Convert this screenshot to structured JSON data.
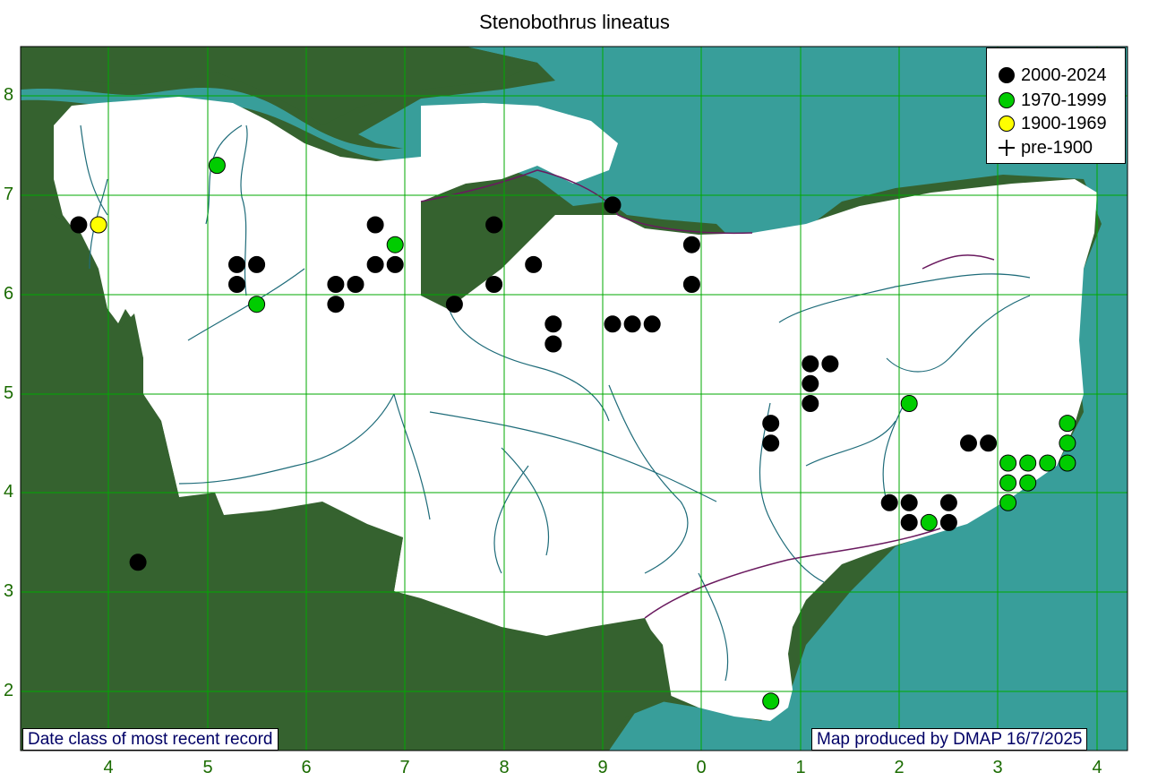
{
  "title": "Stenobothrus lineatus",
  "legend": [
    {
      "label": "2000-2024",
      "symbol": "circle",
      "color": "#000000"
    },
    {
      "label": "1970-1999",
      "symbol": "circle",
      "color": "#00cc00"
    },
    {
      "label": "1900-1969",
      "symbol": "circle",
      "color": "#ffff00"
    },
    {
      "label": "pre-1900",
      "symbol": "cross",
      "color": "#000000"
    }
  ],
  "captions": {
    "left": "Date class of most recent record",
    "right": "Map produced by DMAP 16/7/2025"
  },
  "axes": {
    "x_ticks": [
      "4",
      "5",
      "6",
      "7",
      "8",
      "9",
      "0",
      "1",
      "2",
      "3",
      "4"
    ],
    "y_ticks": [
      "8",
      "7",
      "6",
      "5",
      "4",
      "3",
      "2"
    ]
  },
  "colors": {
    "land_outside": "#35622f",
    "sea": "#389e9a",
    "county": "#ffffff",
    "grid": "#00aa00",
    "rivers": "#1f6c7a",
    "coast_mud": "#6a1a5f"
  },
  "chart_data": {
    "type": "scatter",
    "series": [
      {
        "name": "2000-2024",
        "color": "#000000",
        "points": [
          [
            3.7,
            6.7
          ],
          [
            4.3,
            3.3
          ],
          [
            5.3,
            6.3
          ],
          [
            5.5,
            6.3
          ],
          [
            5.3,
            6.1
          ],
          [
            6.3,
            6.1
          ],
          [
            6.5,
            6.1
          ],
          [
            6.3,
            5.9
          ],
          [
            6.7,
            6.7
          ],
          [
            6.7,
            6.3
          ],
          [
            6.9,
            6.3
          ],
          [
            7.5,
            5.9
          ],
          [
            7.9,
            6.7
          ],
          [
            7.9,
            6.1
          ],
          [
            8.3,
            6.3
          ],
          [
            8.5,
            5.7
          ],
          [
            8.5,
            5.5
          ],
          [
            9.1,
            6.9
          ],
          [
            9.1,
            5.7
          ],
          [
            9.3,
            5.7
          ],
          [
            9.5,
            5.7
          ],
          [
            9.9,
            6.5
          ],
          [
            9.9,
            6.1
          ],
          [
            10.7,
            4.7
          ],
          [
            10.7,
            4.5
          ],
          [
            11.1,
            5.3
          ],
          [
            11.3,
            5.3
          ],
          [
            11.1,
            5.1
          ],
          [
            11.1,
            4.9
          ],
          [
            11.9,
            3.9
          ],
          [
            12.1,
            3.9
          ],
          [
            12.1,
            3.7
          ],
          [
            12.5,
            3.9
          ],
          [
            12.5,
            3.7
          ],
          [
            12.7,
            4.5
          ],
          [
            12.9,
            4.5
          ]
        ]
      },
      {
        "name": "1970-1999",
        "color": "#00cc00",
        "points": [
          [
            5.1,
            7.3
          ],
          [
            5.5,
            5.9
          ],
          [
            6.9,
            6.5
          ],
          [
            10.7,
            1.9
          ],
          [
            12.1,
            4.9
          ],
          [
            12.3,
            3.7
          ],
          [
            13.1,
            4.3
          ],
          [
            13.3,
            4.3
          ],
          [
            13.5,
            4.3
          ],
          [
            13.7,
            4.3
          ],
          [
            13.1,
            4.1
          ],
          [
            13.3,
            4.1
          ],
          [
            13.1,
            3.9
          ],
          [
            13.7,
            4.7
          ],
          [
            13.7,
            4.5
          ]
        ]
      },
      {
        "name": "1900-1969",
        "color": "#ffff00",
        "points": [
          [
            3.9,
            6.7
          ]
        ]
      },
      {
        "name": "pre-1900",
        "color": "#000000",
        "points": []
      }
    ]
  }
}
